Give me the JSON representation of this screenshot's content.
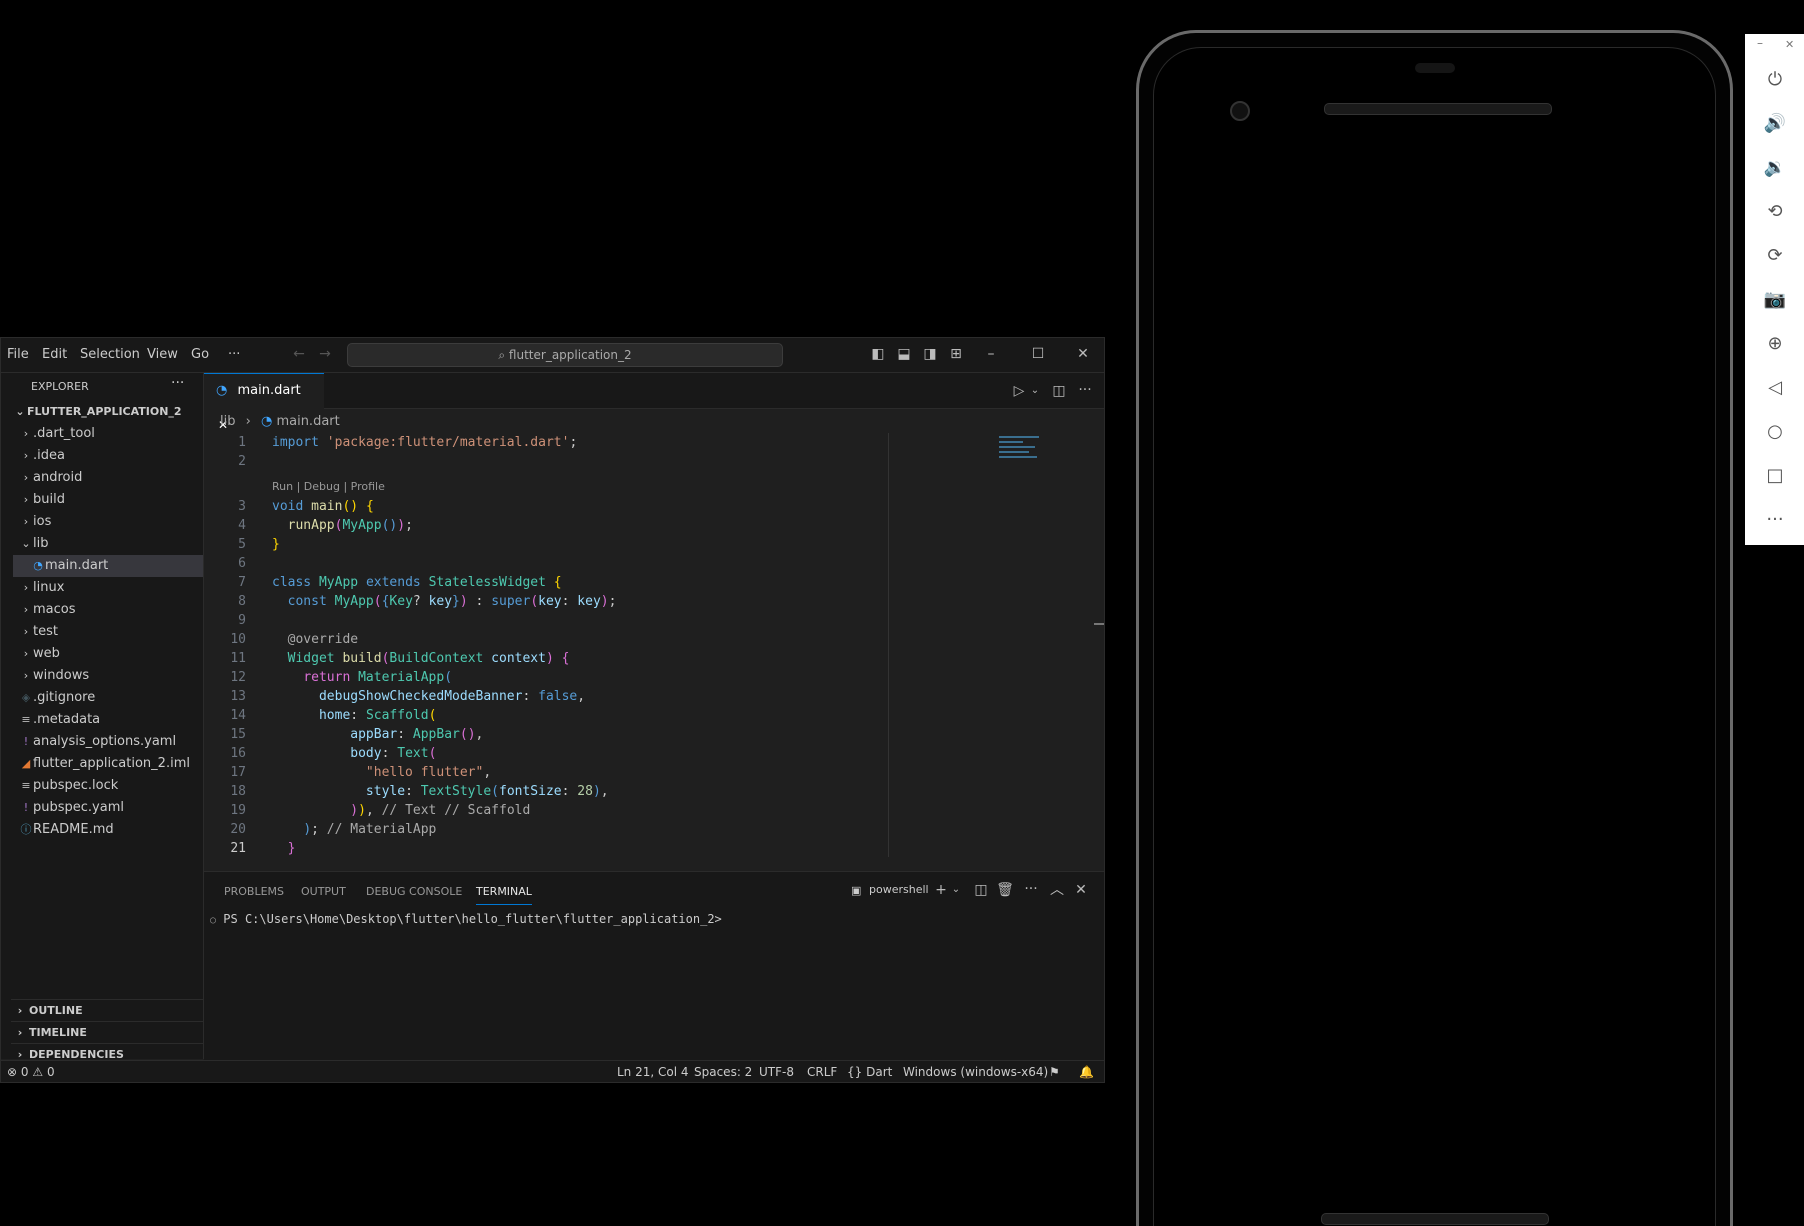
{
  "menu": [
    "File",
    "Edit",
    "Selection",
    "View",
    "Go",
    "···"
  ],
  "search": "flutter_application_2",
  "explorer": {
    "title": "EXPLORER",
    "more": "···",
    "project": "FLUTTER_APPLICATION_2",
    "items": [
      {
        "label": ".dart_tool",
        "icon": "chevron-right"
      },
      {
        "label": ".idea",
        "icon": "chevron-right"
      },
      {
        "label": "android",
        "icon": "chevron-right"
      },
      {
        "label": "build",
        "icon": "chevron-right"
      },
      {
        "label": "ios",
        "icon": "chevron-right"
      },
      {
        "label": "lib",
        "icon": "chevron-down"
      },
      {
        "label": "main.dart",
        "icon": "dart-file"
      },
      {
        "label": "linux",
        "icon": "chevron-right"
      },
      {
        "label": "macos",
        "icon": "chevron-right"
      },
      {
        "label": "test",
        "icon": "chevron-right"
      },
      {
        "label": "web",
        "icon": "chevron-right"
      },
      {
        "label": "windows",
        "icon": "chevron-right"
      },
      {
        "label": ".gitignore",
        "icon": "git-file"
      },
      {
        "label": ".metadata",
        "icon": "lines-file"
      },
      {
        "label": "analysis_options.yaml",
        "icon": "yaml-file"
      },
      {
        "label": "flutter_application_2.iml",
        "icon": "rss-file"
      },
      {
        "label": "pubspec.lock",
        "icon": "lines-file"
      },
      {
        "label": "pubspec.yaml",
        "icon": "yaml-file"
      },
      {
        "label": "README.md",
        "icon": "info-file"
      }
    ],
    "sections": [
      "OUTLINE",
      "TIMELINE",
      "DEPENDENCIES"
    ]
  },
  "tab": {
    "label": "main.dart",
    "close": "✕"
  },
  "breadcrumb": {
    "folder": "lib",
    "sep": "›",
    "file": "main.dart"
  },
  "codelens": "Run | Debug | Profile",
  "line_numbers": [
    "1",
    "2",
    "3",
    "4",
    "5",
    "6",
    "7",
    "8",
    "9",
    "10",
    "11",
    "12",
    "13",
    "14",
    "15",
    "16",
    "17",
    "18",
    "19",
    "20",
    "21"
  ],
  "panel": {
    "tabs": [
      "PROBLEMS",
      "OUTPUT",
      "DEBUG CONSOLE",
      "TERMINAL"
    ],
    "shell": "powershell",
    "prompt": "PS C:\\Users\\Home\\Desktop\\flutter\\hello_flutter\\flutter_application_2>"
  },
  "status": {
    "errors": "0",
    "warnings": "0",
    "position": "Ln 21, Col 4",
    "spaces": "Spaces: 2",
    "encoding": "UTF-8",
    "eol": "CRLF",
    "language": "Dart",
    "platform": "Windows (windows-x64)"
  },
  "emulator": {
    "close": "✕",
    "minimize": "–"
  }
}
